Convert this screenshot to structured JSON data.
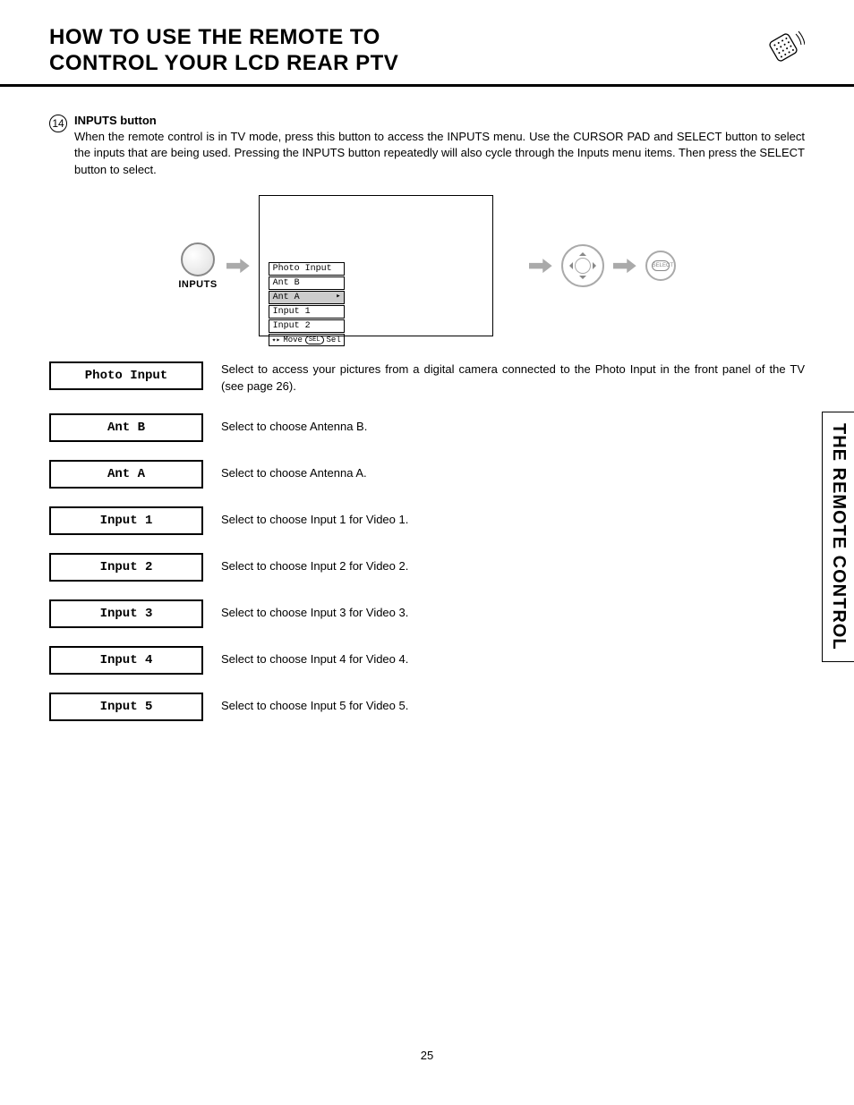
{
  "header": {
    "title_line1": "HOW TO USE THE REMOTE TO",
    "title_line2": "CONTROL YOUR LCD REAR PTV"
  },
  "section": {
    "number": "14",
    "title": "INPUTS button",
    "text": "When the remote control is in TV mode, press this button to access the INPUTS menu.  Use the CURSOR PAD and SELECT button to select the inputs that are being used.  Pressing the INPUTS button repeatedly will also cycle through the Inputs menu items.  Then press the SELECT button to select."
  },
  "figure": {
    "button_label": "INPUTS",
    "menu_items": [
      "Photo Input",
      "Ant B",
      "Ant A",
      "Input 1",
      "Input 2"
    ],
    "selected_index": 2,
    "hint_move": "Move",
    "hint_sel_chip": "SEL",
    "hint_sel": "Sel",
    "select_button_text": "SELECT"
  },
  "options": [
    {
      "label": "Photo Input",
      "desc": "Select to access your pictures from a digital camera connected to the Photo Input in the front panel of the TV (see page 26)."
    },
    {
      "label": "Ant B",
      "desc": "Select to choose Antenna B."
    },
    {
      "label": "Ant A",
      "desc": "Select to choose Antenna A."
    },
    {
      "label": "Input 1",
      "desc": "Select to choose Input 1 for Video 1."
    },
    {
      "label": "Input 2",
      "desc": "Select to choose Input 2 for Video 2."
    },
    {
      "label": "Input 3",
      "desc": "Select to choose Input 3 for Video 3."
    },
    {
      "label": "Input 4",
      "desc": "Select to choose Input 4 for Video 4."
    },
    {
      "label": "Input 5",
      "desc": "Select to choose Input 5 for Video 5."
    }
  ],
  "side_tab": "THE REMOTE CONTROL",
  "page_number": "25"
}
